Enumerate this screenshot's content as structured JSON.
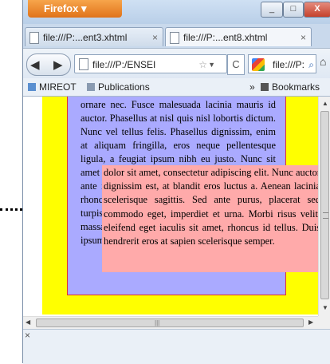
{
  "browser": {
    "app_button": "Firefox ▾",
    "window_buttons": {
      "minimize": "_",
      "maximize": "□",
      "close": "X"
    },
    "tabs": [
      {
        "label": "file:///P:...ent3.xhtml",
        "close": "×"
      },
      {
        "label": "file:///P:...ent8.xhtml",
        "close": "×"
      }
    ],
    "new_tab": "+",
    "url": "file:///P:/ENSEI",
    "search_text": "file:///P:",
    "bookmarks": [
      "MIREOT",
      "Publications",
      "» ",
      "Bookmarks"
    ]
  },
  "page": {
    "blue_text": "ornare nec. Fusce malesuada lacinia mauris id auctor. Phasellus at nisl quis nisl lobortis dictum. Nunc vel tellus felis. Phasellus dignissim, enim at aliquam fringilla, eros neque pellentesque ligula, a feugiat ipsum nibh eu justo. Nunc sit amet mauris id mauris ultrices volutpat. Nullam ante ipsum, fringilla ut congue in, dictum eget rhoncus. Vivamus pellentesque sollicitudin turpis, ac rhoncus orci luctus sit amet. Cras nulla massa, congue id posuere quis, faucibus non ipsum auctor pretium.",
    "pink_text": "dolor sit amet, consectetur adipiscing elit. Nunc auctor dignissim est, at blandit eros luctus a. Aenean lacinia scelerisque sagittis. Sed ante purus, placerat sed commodo eget, imperdiet et urna. Morbi risus velit, eleifend eget iaculis sit amet, rhoncus id tellus. Duis hendrerit eros at sapien scelerisque semper."
  },
  "colors": {
    "yellow_bg": "#ffff00",
    "blue_block": "#aaaaff",
    "pink_block": "#ffaaaa",
    "red_border": "#dd3333"
  }
}
